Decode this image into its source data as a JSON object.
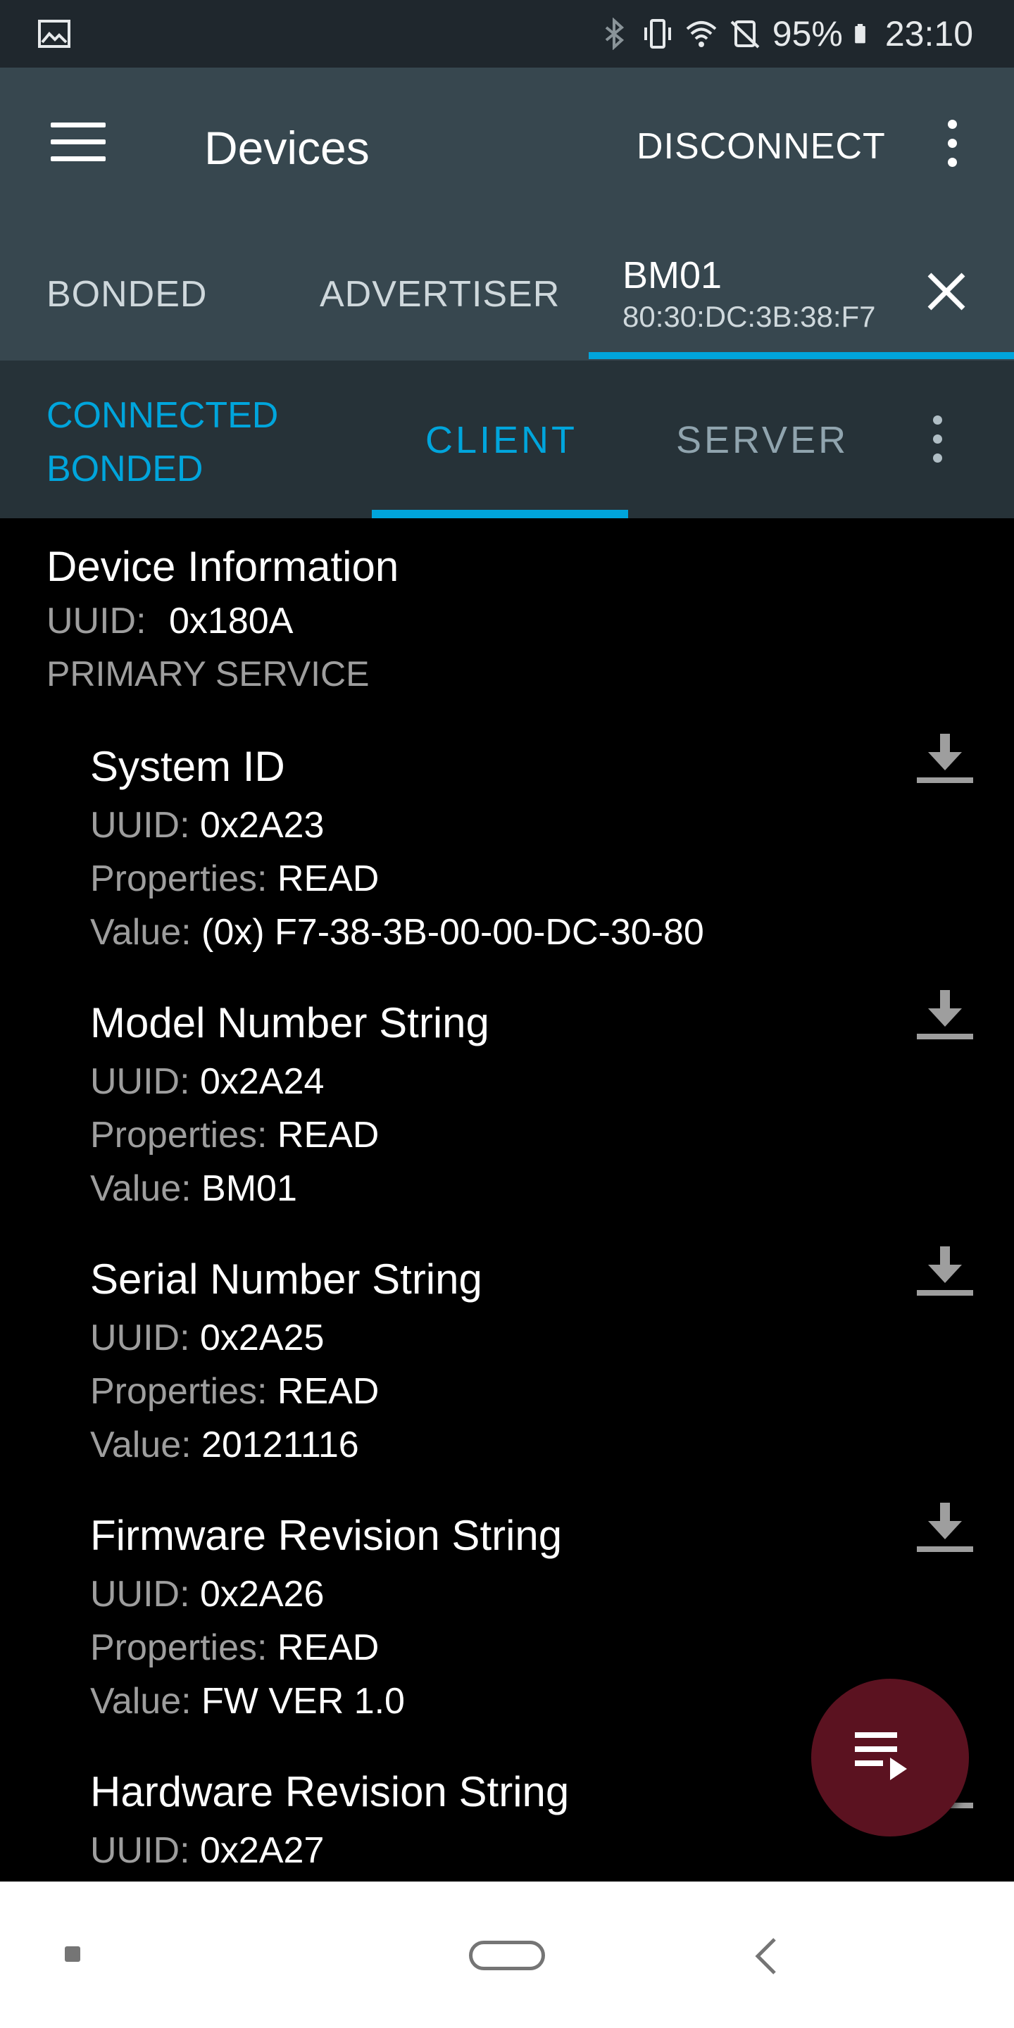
{
  "status_bar": {
    "battery_percent": "95%",
    "time": "23:10",
    "icons": [
      "image-icon",
      "bluetooth-icon",
      "vibrate-icon",
      "wifi-icon",
      "no-sync-icon",
      "battery-icon"
    ]
  },
  "app_bar": {
    "title": "Devices",
    "disconnect_label": "DISCONNECT"
  },
  "device_tabs": {
    "bonded": "BONDED",
    "advertiser": "ADVERTISER",
    "device_name": "BM01",
    "device_address": "80:30:DC:3B:38:F7"
  },
  "connection": {
    "status": "CONNECTED",
    "bond_state": "BONDED",
    "tabs": {
      "client": "CLIENT",
      "server": "SERVER"
    }
  },
  "service": {
    "name": "Device Information",
    "uuid_label": "UUID:",
    "uuid": "0x180A",
    "type": "PRIMARY SERVICE"
  },
  "labels": {
    "uuid": "UUID: ",
    "properties": "Properties: ",
    "value": "Value: "
  },
  "characteristics": [
    {
      "name": "System ID",
      "uuid": "0x2A23",
      "properties": "READ",
      "value": "(0x) F7-38-3B-00-00-DC-30-80"
    },
    {
      "name": "Model Number String",
      "uuid": "0x2A24",
      "properties": "READ",
      "value": "BM01"
    },
    {
      "name": "Serial Number String",
      "uuid": "0x2A25",
      "properties": "READ",
      "value": "20121116"
    },
    {
      "name": "Firmware Revision String",
      "uuid": "0x2A26",
      "properties": "READ",
      "value": "FW VER 1.0"
    },
    {
      "name": "Hardware Revision String",
      "uuid": "0x2A27"
    }
  ],
  "colors": {
    "accent": "#00a5dc",
    "app_bar": "#37474f",
    "status_bar": "#1f272d",
    "connection_bar": "#263238",
    "fab": "#5b1220"
  }
}
